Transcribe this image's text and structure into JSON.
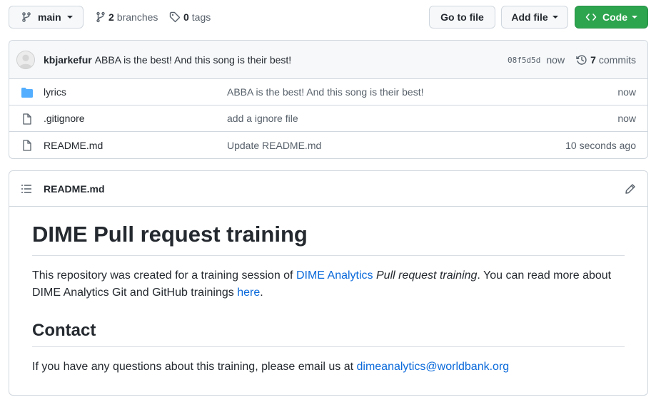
{
  "topbar": {
    "branch": "main",
    "branches_count": "2",
    "branches_label": "branches",
    "tags_count": "0",
    "tags_label": "tags",
    "go_to_file": "Go to file",
    "add_file": "Add file",
    "code": "Code"
  },
  "commit": {
    "author": "kbjarkefur",
    "message": "ABBA is the best! And this song is their best!",
    "sha": "08f5d5d",
    "time": "now",
    "commits_count": "7",
    "commits_label": "commits"
  },
  "files": [
    {
      "name": "lyrics",
      "type": "folder",
      "message": "ABBA is the best! And this song is their best!",
      "time": "now"
    },
    {
      "name": ".gitignore",
      "type": "file",
      "message": "add a ignore file",
      "time": "now"
    },
    {
      "name": "README.md",
      "type": "file",
      "message": "Update README.md",
      "time": "10 seconds ago"
    }
  ],
  "readme": {
    "filename": "README.md",
    "title": "DIME Pull request training",
    "intro_before": "This repository was created for a training session of ",
    "intro_link": "DIME Analytics",
    "intro_space": " ",
    "intro_em": "Pull request training",
    "intro_after": ". You can read more about DIME Analytics Git and GitHub trainings ",
    "intro_here": "here",
    "intro_end": ".",
    "contact_heading": "Contact",
    "contact_text": "If you have any questions about this training, please email us at ",
    "contact_email": "dimeanalytics@worldbank.org"
  },
  "colors": {
    "accent_link": "#0969da",
    "code_button": "#2da44e",
    "folder_icon": "#54aeff"
  }
}
